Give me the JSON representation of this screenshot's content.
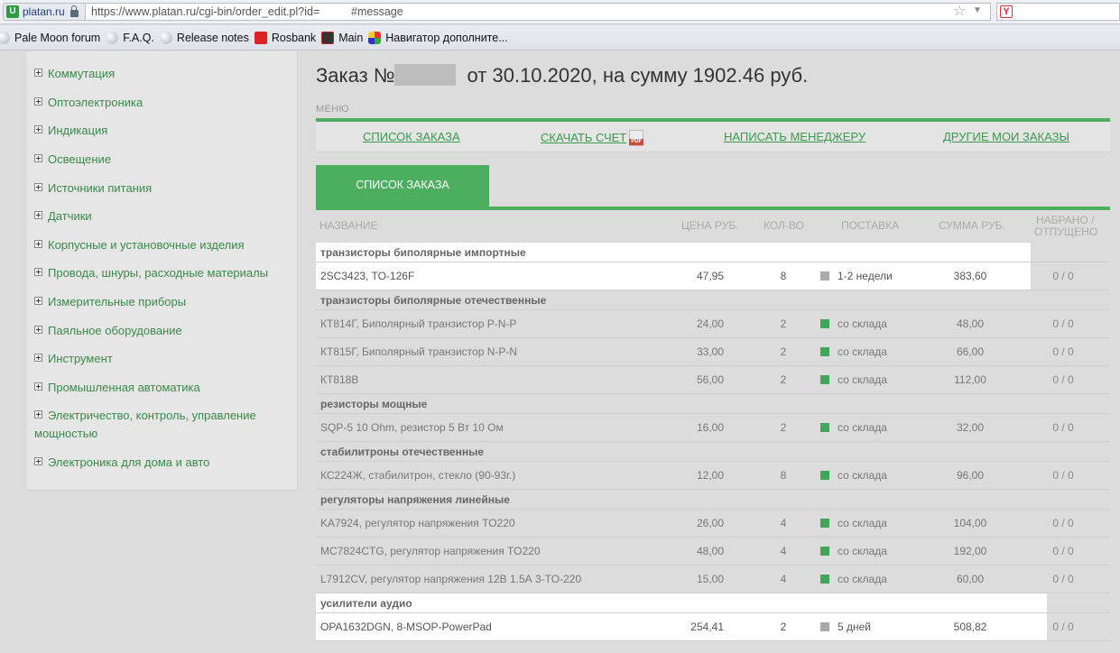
{
  "browser": {
    "site": "platan.ru",
    "url": "https://www.platan.ru/cgi-bin/order_edit.pl?id=",
    "url_host": "platan.ru",
    "url_hash": "#message",
    "bookmarks": [
      "Pale Moon forum",
      "F.A.Q.",
      "Release notes",
      "Rosbank",
      "Main",
      "Навигатор дополните..."
    ]
  },
  "sidebar": {
    "items": [
      "Коммутация",
      "Оптоэлектроника",
      "Индикация",
      "Освещение",
      "Источники питания",
      "Датчики",
      "Корпусные и установочные изделия",
      "Провода, шнуры, расходные материалы",
      "Измерительные приборы",
      "Паяльное оборудование",
      "Инструмент",
      "Промышленная автоматика",
      "Электричество, контроль, управление мощностью",
      "Электроника для дома и авто"
    ]
  },
  "order": {
    "title_prefix": "Заказ №",
    "title_suffix": "от 30.10.2020, на сумму 1902.46 руб.",
    "menu_label": "МЕНЮ",
    "menu": [
      "СПИСОК ЗАКАЗА",
      "СКАЧАТЬ СЧЕТ",
      "НАПИСАТЬ МЕНЕДЖЕРУ",
      "ДРУГИЕ МОИ ЗАКАЗЫ"
    ],
    "tab": "СПИСОК ЗАКАЗА",
    "columns": [
      "НАЗВАНИЕ",
      "ЦЕНА РУБ.",
      "КОЛ-ВО",
      "ПОСТАВКА",
      "СУММА РУБ.",
      "НАБРАНО /",
      "ОТПУЩЕНО"
    ]
  },
  "table": [
    {
      "group": "транзисторы биполярные импортные",
      "white": true
    },
    {
      "name": "2SC3423, TO-126F",
      "price": "47,95",
      "qty": "8",
      "delivery": "1-2 недели",
      "status": "gray",
      "sum": "383,60",
      "picked": "0 / 0",
      "highlight": true
    },
    {
      "group": "транзисторы биполярные отечественные"
    },
    {
      "name": "КТ814Г, Биполярный транзистор P-N-P",
      "price": "24,00",
      "qty": "2",
      "delivery": "со склада",
      "status": "green",
      "sum": "48,00",
      "picked": "0 / 0"
    },
    {
      "name": "КТ815Г, Биполярный транзистор N-P-N",
      "price": "33,00",
      "qty": "2",
      "delivery": "со склада",
      "status": "green",
      "sum": "66,00",
      "picked": "0 / 0"
    },
    {
      "name": "КТ818В",
      "price": "56,00",
      "qty": "2",
      "delivery": "со склада",
      "status": "green",
      "sum": "112,00",
      "picked": "0 / 0"
    },
    {
      "group": "резисторы мощные"
    },
    {
      "name": "SQP-5 10 Ohm, резистор 5 Вт 10 Ом",
      "price": "16,00",
      "qty": "2",
      "delivery": "со склада",
      "status": "green",
      "sum": "32,00",
      "picked": "0 / 0"
    },
    {
      "group": "стабилитроны отечественные"
    },
    {
      "name": "КС224Ж, стабилитрон, стекло (90-93г.)",
      "price": "12,00",
      "qty": "8",
      "delivery": "со склада",
      "status": "green",
      "sum": "96,00",
      "picked": "0 / 0"
    },
    {
      "group": "регуляторы напряжения линейные"
    },
    {
      "name": "KA7924, регулятор напряжения TO220",
      "price": "26,00",
      "qty": "4",
      "delivery": "со склада",
      "status": "green",
      "sum": "104,00",
      "picked": "0 / 0"
    },
    {
      "name": "MC7824CTG, регулятор напряжения TO220",
      "price": "48,00",
      "qty": "4",
      "delivery": "со склада",
      "status": "green",
      "sum": "192,00",
      "picked": "0 / 0"
    },
    {
      "name": "L7912CV, регулятор напряжения 12В 1.5А 3-TO-220",
      "price": "15,00",
      "qty": "4",
      "delivery": "со склада",
      "status": "green",
      "sum": "60,00",
      "picked": "0 / 0"
    },
    {
      "group": "усилители аудио",
      "white": true,
      "wide": true
    },
    {
      "name": "OPA1632DGN, 8-MSOP-PowerPad",
      "price": "254,41",
      "qty": "2",
      "delivery": "5 дней",
      "status": "gray",
      "sum": "508,82",
      "picked": "0 / 0",
      "highlight": true,
      "wide": true
    }
  ],
  "colors": {
    "accent": "#4cae5e",
    "link": "#3a9a4c",
    "in_stock": "#3fa858",
    "on_order": "#aaaaaa"
  }
}
